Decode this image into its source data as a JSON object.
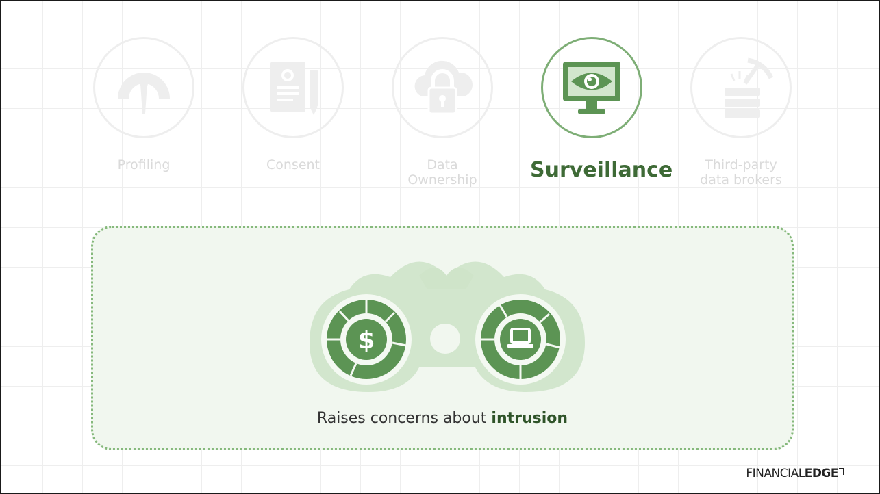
{
  "topics": [
    {
      "label": "Profiling",
      "icon": "gauge-icon",
      "active": false
    },
    {
      "label": "Consent",
      "icon": "document-pen-icon",
      "active": false
    },
    {
      "label": "Data\nOwnership",
      "icon": "cloud-lock-icon",
      "active": false
    },
    {
      "label": "Surveillance",
      "icon": "monitor-eye-icon",
      "active": true
    },
    {
      "label": "Third-party\ndata brokers",
      "icon": "mining-data-icon",
      "active": false
    }
  ],
  "panel": {
    "caption_prefix": "Raises concerns about ",
    "caption_bold": "intrusion",
    "illustration": "binoculars-icon"
  },
  "logo": {
    "part1": "FINANCIAL",
    "part2": "EDGE"
  },
  "colors": {
    "accent_dark": "#3e6a36",
    "accent": "#5c9454",
    "accent_light": "#d2e6cd",
    "panel_bg": "#f1f7ef",
    "inactive": "#eeeeee"
  }
}
